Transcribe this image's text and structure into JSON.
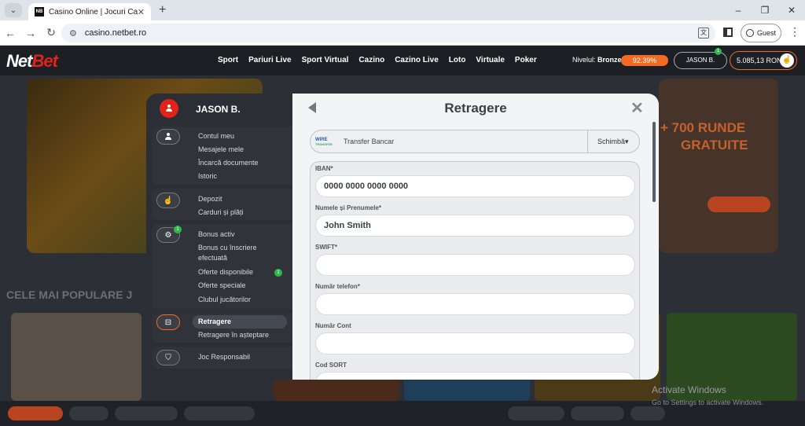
{
  "browser": {
    "tab_title": "Casino Online | Jocuri Cazino Or",
    "favicon_text": "NB",
    "url": "casino.netbet.ro",
    "profile_label": "Guest"
  },
  "header": {
    "logo_net": "Net",
    "logo_bet": "Bet",
    "nav": [
      "Sport",
      "Pariuri Live",
      "Sport Virtual",
      "Cazino",
      "Cazino Live",
      "Loto",
      "Virtuale",
      "Poker"
    ],
    "level_label": "Nivelul:",
    "level_value": "Bronze",
    "level_progress": "92.39%",
    "user_button": "JASON B.",
    "user_notifications": "1",
    "balance": "5.085,13 RON"
  },
  "background": {
    "promo_line1": "+ 700 RUNDE",
    "promo_line2": "GRATUITE",
    "section_title": "CELE MAI POPULARE J",
    "activate_title": "Activate Windows",
    "activate_sub": "Go to Settings to activate Windows."
  },
  "account_menu": {
    "username": "JASON B.",
    "groups": [
      {
        "items": [
          "Contul meu",
          "Mesajele mele",
          "Încarcă documente",
          "Istoric"
        ]
      },
      {
        "items": [
          "Depozit",
          "Carduri și plăți"
        ]
      },
      {
        "items": [
          "Bonus activ",
          "Bonus cu înscriere efectuată",
          "Oferte disponibile",
          "Oferte speciale",
          "Clubul jucătorilor"
        ],
        "badge": "1",
        "offers_badge": "1"
      },
      {
        "items": [
          "Retragere",
          "Retragere în așteptare"
        ]
      },
      {
        "items": [
          "Joc Responsabil"
        ]
      }
    ],
    "bonus_item_line1": "Bonus cu înscriere",
    "bonus_item_line2": "efectuată"
  },
  "withdraw": {
    "title": "Retragere",
    "method_logo_top": "WIRE",
    "method_logo_bottom": "TRANSFER",
    "method_name": "Transfer Bancar",
    "change_label": "Schimbă",
    "fields": [
      {
        "label": "IBAN*",
        "value": "0000 0000 0000 0000"
      },
      {
        "label": "Numele și Prenumele*",
        "value": "John Smith"
      },
      {
        "label": "SWIFT*",
        "value": ""
      },
      {
        "label": "Număr telefon*",
        "value": ""
      },
      {
        "label": "Număr Cont",
        "value": ""
      },
      {
        "label": "Cod SORT",
        "value": ""
      }
    ]
  }
}
